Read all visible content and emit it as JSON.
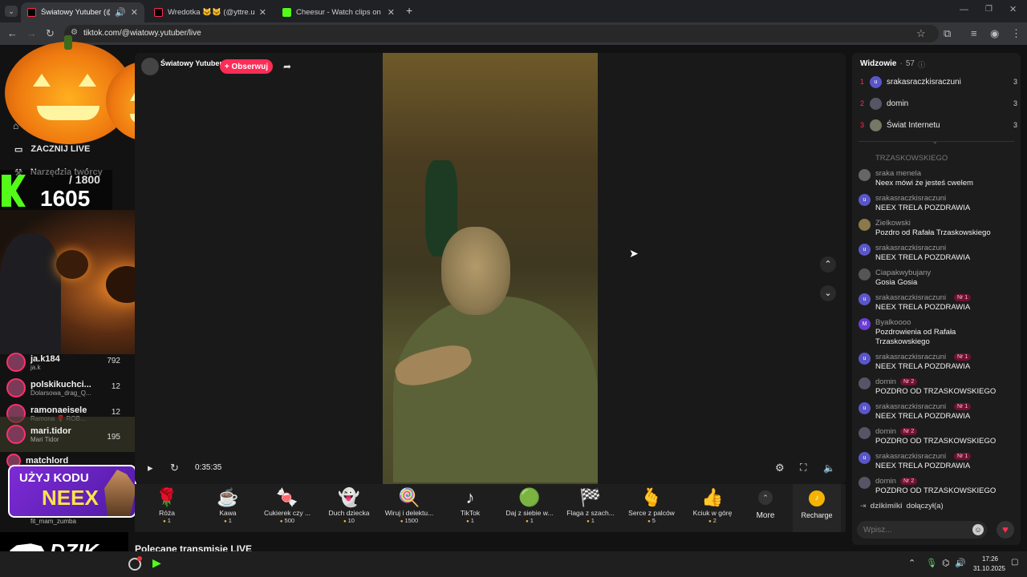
{
  "browser": {
    "tabs": [
      {
        "title": "Światowy Yutuber (@wiato",
        "color": "#fe2c55"
      },
      {
        "title": "Wredotka 🐱🐱 (@yttre.uuty)",
        "color": "#fe2c55"
      },
      {
        "title": "Cheesur - Watch clips on Kick",
        "color": "#53fc18"
      }
    ],
    "url": "tiktok.com/@wiatowy.yutuber/live"
  },
  "overlay": {
    "counter_goal": "/ 1800",
    "counter_value": "1605",
    "promo_line1": "UŻYJ KODU",
    "promo_line2": "NEEX",
    "logo": "DZIK"
  },
  "sidebar": {
    "items": [
      "ZACZNIJ LIVE",
      "Narzędzia twórcy"
    ],
    "live_users": [
      {
        "name": "ja.k184",
        "sub": "ja.k",
        "count": "792"
      },
      {
        "name": "polskikuchci...",
        "sub": "Dolarsowa_drag_Q...",
        "count": "12"
      },
      {
        "name": "ramonaeisele",
        "sub": "Ramona 🌹 ROB...",
        "count": "12"
      },
      {
        "name": "mari.tidor",
        "sub": "Mari Tidor",
        "count": "195"
      },
      {
        "name": "matchlord",
        "sub": "",
        "count": ""
      }
    ],
    "bottom_user": "fit_mam_zumba"
  },
  "stream": {
    "creator": "Światowy Yutuber",
    "follow_label": "+ Obserwuj",
    "timer": "0:35:35",
    "recommended": "Polecane transmisje LIVE"
  },
  "gifts": [
    {
      "name": "Róża",
      "price": "1",
      "icon": "🌹"
    },
    {
      "name": "Kawa",
      "price": "1",
      "icon": "☕"
    },
    {
      "name": "Cukierek czy ...",
      "price": "500",
      "icon": "🍬"
    },
    {
      "name": "Duch dziecka",
      "price": "10",
      "icon": "👻"
    },
    {
      "name": "Wiruj i delektu...",
      "price": "1500",
      "icon": "🍭"
    },
    {
      "name": "TikTok",
      "price": "1",
      "icon": "♪"
    },
    {
      "name": "Daj z siebie w...",
      "price": "1",
      "icon": "🟢"
    },
    {
      "name": "Flaga z szach...",
      "price": "1",
      "icon": "🏁"
    },
    {
      "name": "Serce z palców",
      "price": "5",
      "icon": "🫰"
    },
    {
      "name": "Kciuk w górę",
      "price": "2",
      "icon": "👍"
    }
  ],
  "gift_more": "More",
  "recharge": "Recharge",
  "viewers": {
    "title": "Widzowie",
    "count": "57",
    "top": [
      {
        "rank": "1",
        "name": "srakasraczkisraczuni",
        "score": "3"
      },
      {
        "rank": "2",
        "name": "domin",
        "score": "3"
      },
      {
        "rank": "3",
        "name": "Świat Internetu",
        "score": "3"
      }
    ]
  },
  "chat": {
    "cut_line": "TRZASKOWSKIEGO",
    "messages": [
      {
        "user": "sraka menela",
        "badge": "",
        "text": "Neex mówi że jesteś cwelem"
      },
      {
        "user": "srakasraczkisraczuni",
        "badge": "",
        "text": "NEEX TRELA POZDRAWIA"
      },
      {
        "user": "Zielkowski",
        "badge": "",
        "text": "Pozdro od Rafała Trzaskowskiego"
      },
      {
        "user": "srakasraczkisraczuni",
        "badge": "",
        "text": "NEEX TRELA POZDRAWIA"
      },
      {
        "user": "Ciapakwybujany",
        "badge": "",
        "text": "Gosia Gosia"
      },
      {
        "user": "srakasraczkisraczuni",
        "badge": "Nr 1",
        "text": "NEEX TRELA POZDRAWIA"
      },
      {
        "user": "Byalkoooo",
        "badge": "",
        "text": "Pozdrowienia od Rafała Trzaskowskiego"
      },
      {
        "user": "srakasraczkisraczuni",
        "badge": "Nr 1",
        "text": "NEEX TRELA POZDRAWIA"
      },
      {
        "user": "domin",
        "badge": "Nr 2",
        "text": "POZDRO OD TRZASKOWSKIEGO"
      },
      {
        "user": "srakasraczkisraczuni",
        "badge": "Nr 1",
        "text": "NEEX TRELA POZDRAWIA"
      },
      {
        "user": "domin",
        "badge": "Nr 2",
        "text": "POZDRO OD TRZASKOWSKIEGO"
      },
      {
        "user": "srakasraczkisraczuni",
        "badge": "Nr 1",
        "text": "NEEX TRELA POZDRAWIA"
      },
      {
        "user": "domin",
        "badge": "Nr 2",
        "text": "POZDRO OD TRZASKOWSKIEGO"
      }
    ],
    "join_user": "dzikimiki",
    "join_text": "dołączył(a)",
    "placeholder": "Wpisz..."
  },
  "taskbar": {
    "time": "17:26",
    "date": "31.10.2025"
  }
}
